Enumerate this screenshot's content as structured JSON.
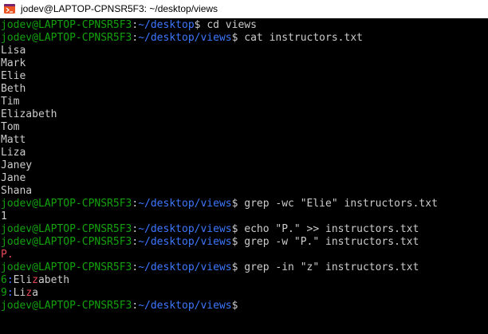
{
  "window": {
    "title": "jodev@LAPTOP-CPNSR5F3: ~/desktop/views",
    "icon": "ubuntu-terminal-icon"
  },
  "colors": {
    "prompt_user": "#13a10e",
    "prompt_path": "#3b78ff",
    "match": "#e74856",
    "text": "#cccccc",
    "background": "#000000"
  },
  "terminal": {
    "lines": [
      {
        "type": "prompt",
        "user": "jodev@LAPTOP-CPNSR5F3",
        "path": "~/desktop",
        "symbol": "$ ",
        "command": "cd views"
      },
      {
        "type": "prompt",
        "user": "jodev@LAPTOP-CPNSR5F3",
        "path": "~/desktop/views",
        "symbol": "$ ",
        "command": "cat instructors.txt"
      },
      {
        "type": "output",
        "text": "Lisa"
      },
      {
        "type": "output",
        "text": "Mark"
      },
      {
        "type": "output",
        "text": "Elie"
      },
      {
        "type": "output",
        "text": "Beth"
      },
      {
        "type": "output",
        "text": "Tim"
      },
      {
        "type": "output",
        "text": "Elizabeth"
      },
      {
        "type": "output",
        "text": "Tom"
      },
      {
        "type": "output",
        "text": "Matt"
      },
      {
        "type": "output",
        "text": "Liza"
      },
      {
        "type": "output",
        "text": "Janey"
      },
      {
        "type": "output",
        "text": "Jane"
      },
      {
        "type": "output",
        "text": "Shana"
      },
      {
        "type": "prompt",
        "user": "jodev@LAPTOP-CPNSR5F3",
        "path": "~/desktop/views",
        "symbol": "$ ",
        "command": "grep -wc \"Elie\" instructors.txt"
      },
      {
        "type": "output",
        "text": "1"
      },
      {
        "type": "prompt",
        "user": "jodev@LAPTOP-CPNSR5F3",
        "path": "~/desktop/views",
        "symbol": "$ ",
        "command": "echo \"P.\" >> instructors.txt"
      },
      {
        "type": "prompt",
        "user": "jodev@LAPTOP-CPNSR5F3",
        "path": "~/desktop/views",
        "symbol": "$ ",
        "command": "grep -w \"P.\" instructors.txt"
      },
      {
        "type": "match",
        "segments": [
          {
            "t": "P.",
            "c": "match"
          }
        ]
      },
      {
        "type": "prompt",
        "user": "jodev@LAPTOP-CPNSR5F3",
        "path": "~/desktop/views",
        "symbol": "$ ",
        "command": "grep -in \"z\" instructors.txt"
      },
      {
        "type": "match",
        "segments": [
          {
            "t": "6",
            "c": "lnum"
          },
          {
            "t": ":",
            "c": "sep"
          },
          {
            "t": "Eli",
            "c": "plain"
          },
          {
            "t": "z",
            "c": "match"
          },
          {
            "t": "abeth",
            "c": "plain"
          }
        ]
      },
      {
        "type": "match",
        "segments": [
          {
            "t": "9",
            "c": "lnum"
          },
          {
            "t": ":",
            "c": "sep"
          },
          {
            "t": "Li",
            "c": "plain"
          },
          {
            "t": "z",
            "c": "match"
          },
          {
            "t": "a",
            "c": "plain"
          }
        ]
      },
      {
        "type": "prompt",
        "user": "jodev@LAPTOP-CPNSR5F3",
        "path": "~/desktop/views",
        "symbol": "$ ",
        "command": ""
      }
    ]
  }
}
